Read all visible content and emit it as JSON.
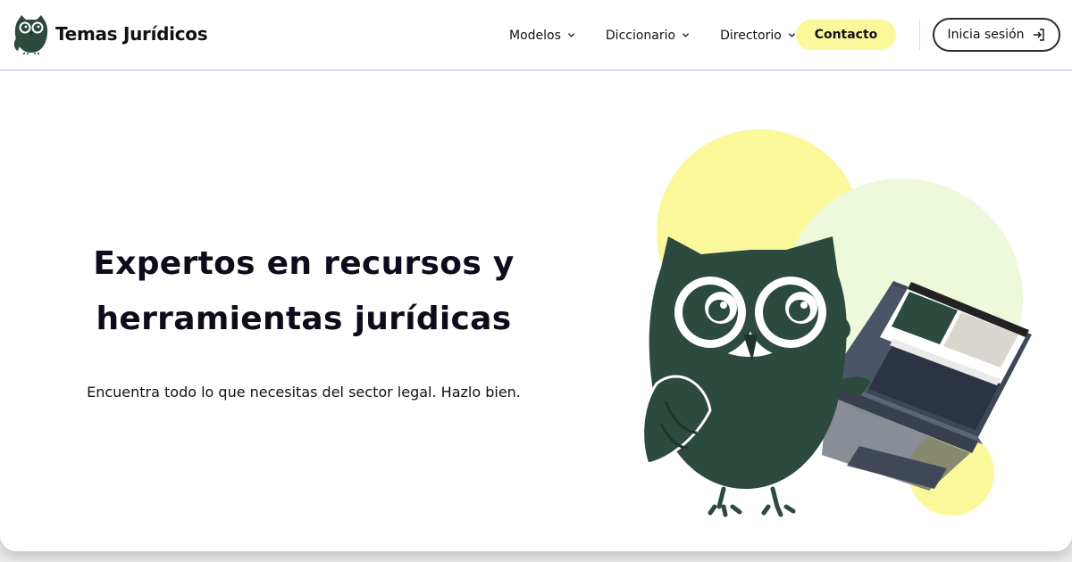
{
  "header": {
    "brand": "Temas Jurídicos",
    "nav": [
      {
        "label": "Modelos"
      },
      {
        "label": "Diccionario"
      },
      {
        "label": "Directorio"
      }
    ],
    "contact_label": "Contacto",
    "login_label": "Inicia sesión"
  },
  "hero": {
    "headline_line1": "Expertos en recursos y",
    "headline_line2": "herramientas jurídicas",
    "subtitle": "Encuentra todo lo que necesitas del sector legal. Hazlo bien."
  },
  "colors": {
    "brand_green": "#2d4a3e",
    "accent_yellow": "#fbf89b",
    "light_green": "#eef9dc",
    "header_border": "#c9a9d6"
  },
  "icons": {
    "logo": "owl-logo-icon",
    "dropdown": "chevron-down-icon",
    "login": "sign-in-icon"
  }
}
